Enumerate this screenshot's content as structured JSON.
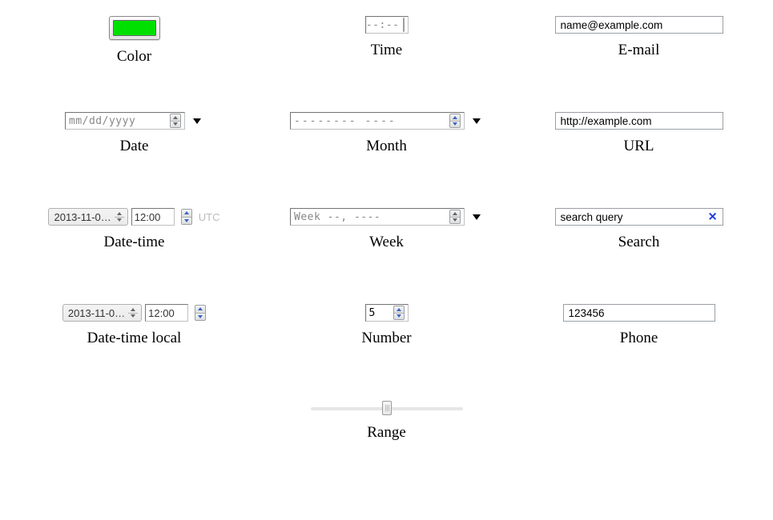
{
  "color": {
    "label": "Color",
    "value": "#00e000"
  },
  "time": {
    "label": "Time",
    "value": "--:--"
  },
  "email": {
    "label": "E-mail",
    "value": "name@example.com"
  },
  "date": {
    "label": "Date",
    "value": "mm/dd/yyyy"
  },
  "month": {
    "label": "Month",
    "value": "-------- ----"
  },
  "url": {
    "label": "URL",
    "value": "http://example.com"
  },
  "datetime": {
    "label": "Date-time",
    "date": "2013-11-0…",
    "time": "12:00",
    "tz": "UTC"
  },
  "week": {
    "label": "Week",
    "value": "Week --, ----"
  },
  "search": {
    "label": "Search",
    "value": "search query"
  },
  "datetime_local": {
    "label": "Date-time local",
    "date": "2013-11-0…",
    "time": "12:00"
  },
  "number": {
    "label": "Number",
    "value": "5"
  },
  "phone": {
    "label": "Phone",
    "value": "123456"
  },
  "range": {
    "label": "Range"
  }
}
